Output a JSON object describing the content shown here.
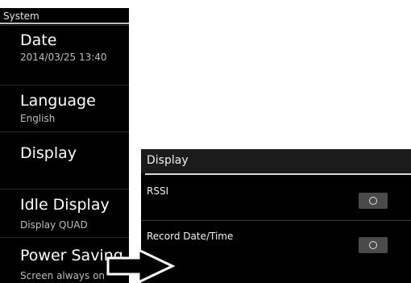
{
  "left_panel": {
    "header": "System",
    "items": [
      {
        "title": "Date",
        "subtitle": "2014/03/25 13:40"
      },
      {
        "title": "Language",
        "subtitle": "English"
      },
      {
        "title": "Display",
        "subtitle": ""
      },
      {
        "title": "Idle Display",
        "subtitle": "Display QUAD"
      },
      {
        "title": "Power Saving",
        "subtitle": "Screen always on"
      }
    ]
  },
  "right_panel": {
    "header": "Display",
    "rows": [
      {
        "label": "RSSI",
        "toggle_symbol": "O"
      },
      {
        "label": "Record Date/Time",
        "toggle_symbol": "O"
      }
    ]
  },
  "colors": {
    "panel_background": "#000000",
    "header_rule": "#bdbdbd",
    "subtitle_text": "#bdbdbd",
    "toggle_background": "#4a4a4a"
  },
  "icons": {
    "transition_arrow": "right-arrow-icon"
  }
}
